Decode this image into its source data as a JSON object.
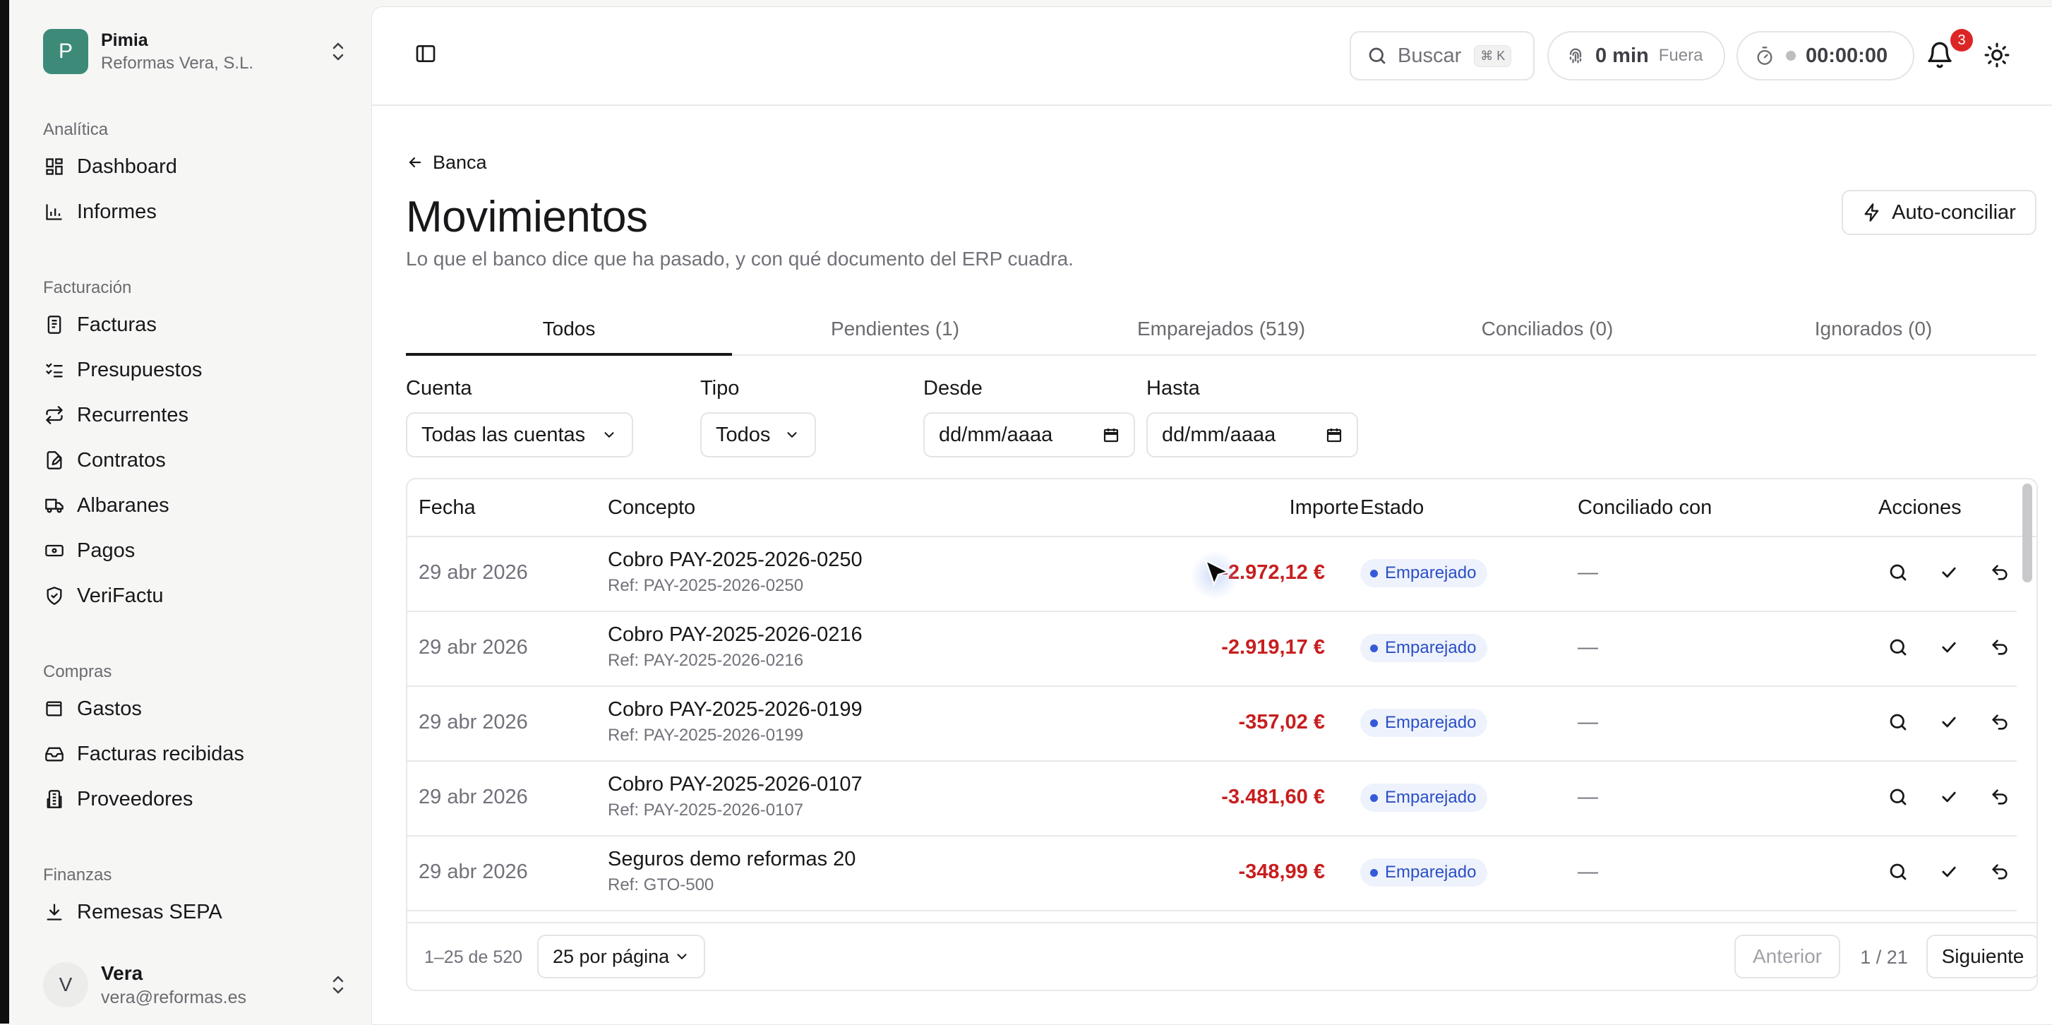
{
  "org": {
    "initial": "P",
    "name": "Pimia",
    "company": "Reformas Vera, S.L."
  },
  "sidebar": {
    "groups": [
      {
        "title": "Analítica",
        "items": [
          "Dashboard",
          "Informes"
        ]
      },
      {
        "title": "Facturación",
        "items": [
          "Facturas",
          "Presupuestos",
          "Recurrentes",
          "Contratos",
          "Albaranes",
          "Pagos",
          "VeriFactu"
        ]
      },
      {
        "title": "Compras",
        "items": [
          "Gastos",
          "Facturas recibidas",
          "Proveedores"
        ]
      },
      {
        "title": "Finanzas",
        "items": [
          "Remesas SEPA"
        ]
      }
    ]
  },
  "user": {
    "initial": "V",
    "name": "Vera",
    "email": "vera@reformas.es"
  },
  "topbar": {
    "search_label": "Buscar",
    "search_shortcut": "⌘ K",
    "presence_value": "0 min",
    "presence_status": "Fuera",
    "timer": "00:00:00",
    "notifications_count": "3"
  },
  "page": {
    "back_label": "Banca",
    "title": "Movimientos",
    "subtitle": "Lo que el banco dice que ha pasado, y con qué documento del ERP cuadra.",
    "auto_button": "Auto-conciliar"
  },
  "tabs": [
    "Todos",
    "Pendientes (1)",
    "Emparejados (519)",
    "Conciliados (0)",
    "Ignorados (0)"
  ],
  "active_tab": 0,
  "filters": {
    "account_label": "Cuenta",
    "account_value": "Todas las cuentas",
    "type_label": "Tipo",
    "type_value": "Todos",
    "from_label": "Desde",
    "from_value": "dd/mm/aaaa",
    "to_label": "Hasta",
    "to_value": "dd/mm/aaaa"
  },
  "table": {
    "headers": [
      "Fecha",
      "Concepto",
      "Importe",
      "Estado",
      "Conciliado con",
      "Acciones"
    ],
    "rows": [
      {
        "date": "29 abr 2026",
        "concept": "Cobro PAY-2025-2026-0250",
        "ref": "Ref: PAY-2025-2026-0250",
        "amount": "-2.972,12 €",
        "state": "Emparejado",
        "reconciled": "—"
      },
      {
        "date": "29 abr 2026",
        "concept": "Cobro PAY-2025-2026-0216",
        "ref": "Ref: PAY-2025-2026-0216",
        "amount": "-2.919,17 €",
        "state": "Emparejado",
        "reconciled": "—"
      },
      {
        "date": "29 abr 2026",
        "concept": "Cobro PAY-2025-2026-0199",
        "ref": "Ref: PAY-2025-2026-0199",
        "amount": "-357,02 €",
        "state": "Emparejado",
        "reconciled": "—"
      },
      {
        "date": "29 abr 2026",
        "concept": "Cobro PAY-2025-2026-0107",
        "ref": "Ref: PAY-2025-2026-0107",
        "amount": "-3.481,60 €",
        "state": "Emparejado",
        "reconciled": "—"
      },
      {
        "date": "29 abr 2026",
        "concept": "Seguros demo reformas 20",
        "ref": "Ref: GTO-500",
        "amount": "-348,99 €",
        "state": "Emparejado",
        "reconciled": "—"
      }
    ]
  },
  "pagination": {
    "count": "1–25 de 520",
    "per_page": "25 por página",
    "prev": "Anterior",
    "page": "1 / 21",
    "next": "Siguiente"
  },
  "colors": {
    "accent": "#3d8a79",
    "negative_amount": "#c81e1e",
    "badge_bg": "#eef2fc",
    "badge_text": "#2a4fc4",
    "notification": "#dc2626"
  }
}
